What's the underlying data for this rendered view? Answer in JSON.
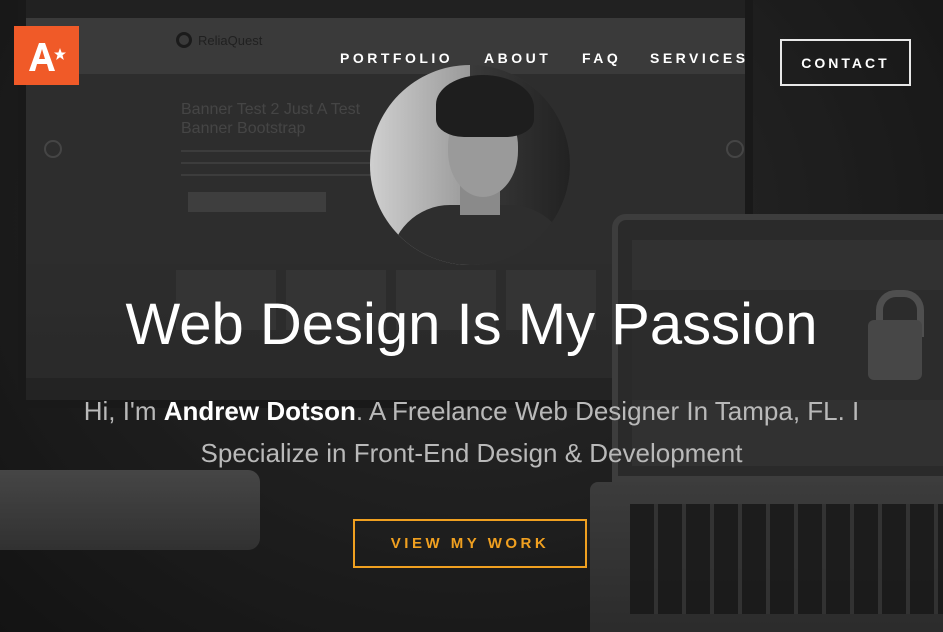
{
  "brand": {
    "logo_icon": "a-star-logo-icon",
    "logo_color": "#f05a28"
  },
  "nav": {
    "items": [
      {
        "label": "PORTFOLIO"
      },
      {
        "label": "ABOUT"
      },
      {
        "label": "FAQ"
      },
      {
        "label": "SERVICES"
      }
    ],
    "contact_label": "CONTACT"
  },
  "background": {
    "monitor_site_logo": "ReliaQuest",
    "monitor_banner_heading": "Banner Test 2 Just A Test Banner Bootstrap"
  },
  "hero": {
    "avatar_icon": "profile-photo",
    "headline": "Web Design Is My Passion",
    "intro_before_name": "Hi, I'm ",
    "name": "Andrew Dotson",
    "intro_after_name": ". A Freelance Web Designer In Tampa, FL. I Specialize in Front-End Design & Development",
    "cta_label": "VIEW MY WORK",
    "cta_color": "#f0a020"
  }
}
